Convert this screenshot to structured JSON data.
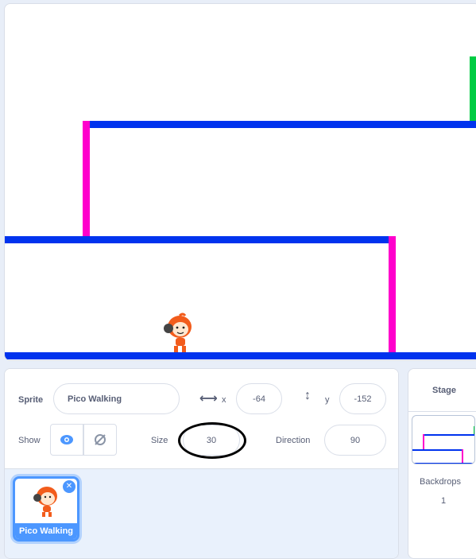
{
  "stage": {
    "colors": {
      "platform": "#0033ee",
      "wall": "#ff00cc",
      "goal": "#00cc44"
    }
  },
  "sprite_info": {
    "sprite_label": "Sprite",
    "sprite_name": "Pico Walking",
    "x_label": "x",
    "x_value": "-64",
    "y_label": "y",
    "y_value": "-152",
    "show_label": "Show",
    "size_label": "Size",
    "size_value": "30",
    "direction_label": "Direction",
    "direction_value": "90"
  },
  "sprite_list": {
    "items": [
      {
        "label": "Pico Walking",
        "selected": true
      }
    ]
  },
  "stage_pane": {
    "title": "Stage",
    "backdrops_label": "Backdrops",
    "backdrops_count": "1"
  }
}
